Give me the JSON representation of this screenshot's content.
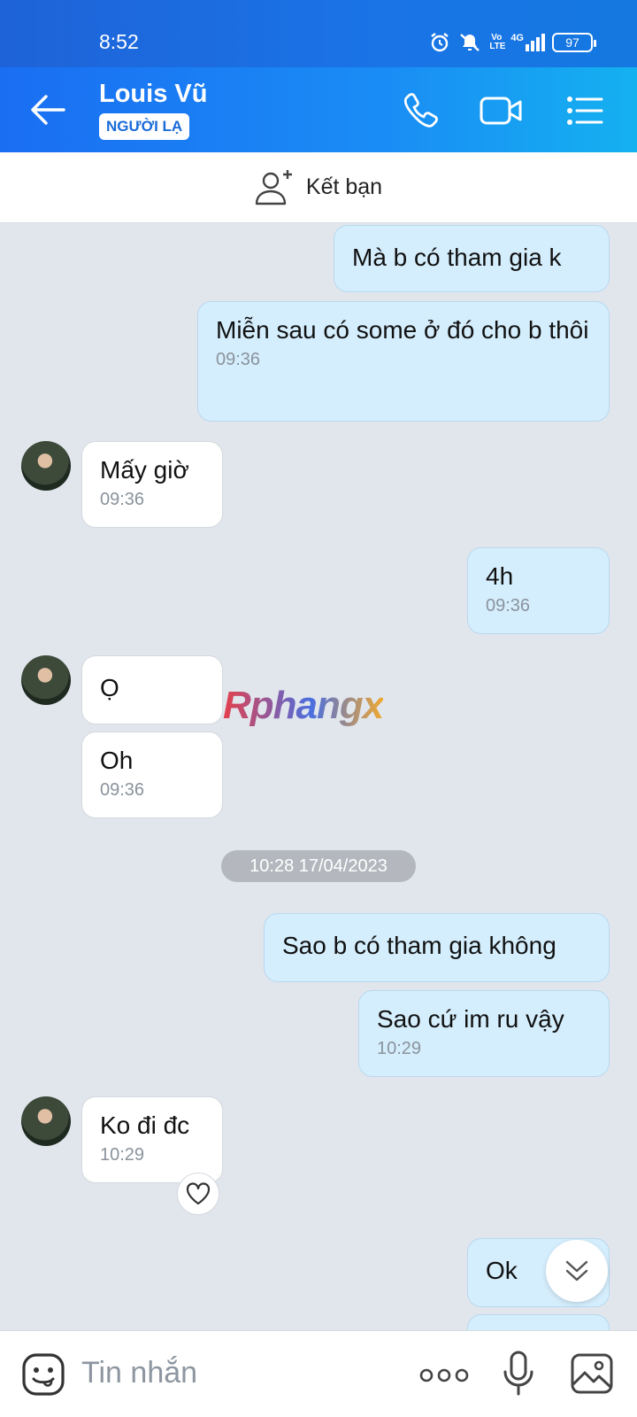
{
  "status": {
    "time": "8:52",
    "volte": "Vo LTE",
    "network": "4G",
    "battery": "97"
  },
  "header": {
    "contact_name": "Louis Vũ",
    "badge": "NGƯỜI LẠ"
  },
  "friend_bar": {
    "label": "Kết bạn"
  },
  "messages": [
    {
      "dir": "out",
      "text": "Mà b có tham gia k",
      "time": ""
    },
    {
      "dir": "out",
      "text": "Miễn sau có some ở đó cho b thôi",
      "time": "09:36"
    },
    {
      "dir": "in",
      "text": "Mấy giờ",
      "time": "09:36"
    },
    {
      "dir": "out",
      "text": "4h",
      "time": "09:36"
    },
    {
      "dir": "in",
      "text": "Ọ",
      "time": ""
    },
    {
      "dir": "in",
      "text": "Oh",
      "time": "09:36"
    },
    {
      "dir": "out",
      "text": "Sao b có tham gia không",
      "time": ""
    },
    {
      "dir": "out",
      "text": "Sao cứ im ru vậy",
      "time": "10:29"
    },
    {
      "dir": "in",
      "text": "Ko đi đc",
      "time": "10:29"
    },
    {
      "dir": "out",
      "text": "Ok",
      "time": ""
    }
  ],
  "date_divider": "10:28 17/04/2023",
  "watermark": "Rphangx",
  "input": {
    "placeholder": "Tin nhắn"
  },
  "colors": {
    "header_start": "#1a6ef2",
    "header_end": "#14b1f0",
    "outgoing_bubble": "#d5eefd",
    "incoming_bubble": "#ffffff",
    "background": "#e1e6ed"
  }
}
